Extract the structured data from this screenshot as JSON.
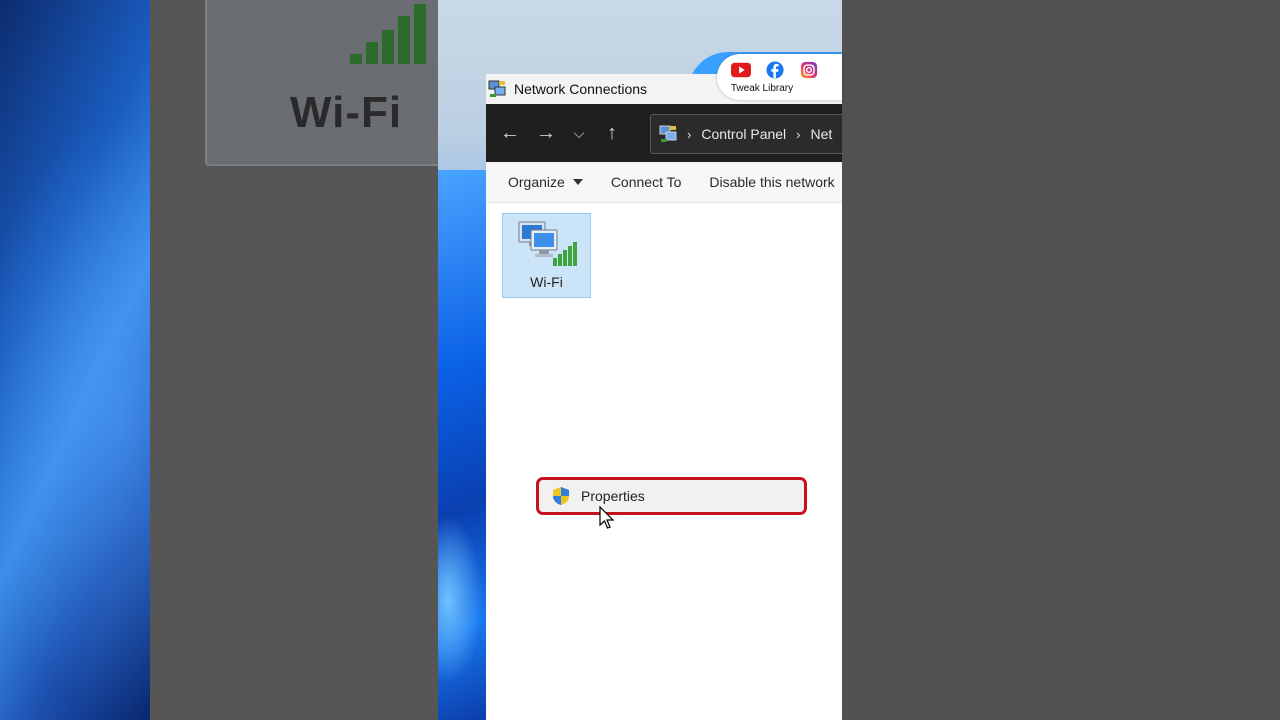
{
  "background": {
    "blurred_label": "Wi-Fi"
  },
  "window": {
    "title": "Network Connections",
    "app_icon": "network-connections-icon"
  },
  "navigation": {
    "back_icon": "arrow-left-icon",
    "forward_icon": "arrow-right-icon",
    "recent_icon": "chevron-down-icon",
    "up_icon": "arrow-up-icon",
    "address_path": [
      "Control Panel",
      "Net"
    ]
  },
  "toolbar": {
    "organize_label": "Organize",
    "connect_label": "Connect To",
    "disable_label": "Disable this network"
  },
  "connections": [
    {
      "label": "Wi-Fi",
      "icon": "wifi-adapter-icon",
      "selected": true
    }
  ],
  "context_menu": {
    "item_label": "Properties",
    "item_icon": "uac-shield-icon",
    "highlight_color": "#c4121f"
  },
  "social": {
    "label": "Tweak Library",
    "icons": [
      "youtube-icon",
      "facebook-icon",
      "instagram-icon"
    ]
  }
}
